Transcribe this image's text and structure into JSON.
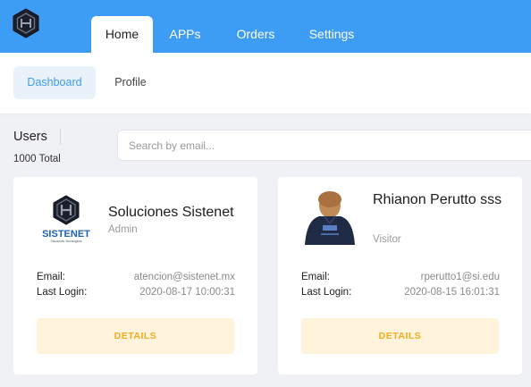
{
  "brand": {
    "logo_icon": "sistenet-hexagon-logo"
  },
  "nav": {
    "tabs": [
      {
        "label": "Home",
        "active": true
      },
      {
        "label": "APPs",
        "active": false
      },
      {
        "label": "Orders",
        "active": false
      },
      {
        "label": "Settings",
        "active": false
      }
    ]
  },
  "subnav": {
    "tabs": [
      {
        "label": "Dashboard",
        "active": true
      },
      {
        "label": "Profile",
        "active": false
      }
    ]
  },
  "users": {
    "title": "Users",
    "total": "1000 Total"
  },
  "search": {
    "placeholder": "Search by email...",
    "value": ""
  },
  "labels": {
    "email": "Email:",
    "last_login": "Last Login:",
    "details": "DETAILS"
  },
  "cards": [
    {
      "name": "Soluciones Sistenet",
      "role": "Admin",
      "email": "atencion@sistenet.mx",
      "last_login": "2020-08-17 10:00:31",
      "logo_text": "SISTENET",
      "logo_subtext": "Soluciones Tecnológicas"
    },
    {
      "name": "Rhianon Perutto sss",
      "role": "Visitor",
      "email": "rperutto1@si.edu",
      "last_login": "2020-08-15 16:01:31"
    }
  ],
  "colors": {
    "accent": "#3d9cf4",
    "details_bg": "#fff3dc",
    "details_text": "#f0ac1d"
  }
}
